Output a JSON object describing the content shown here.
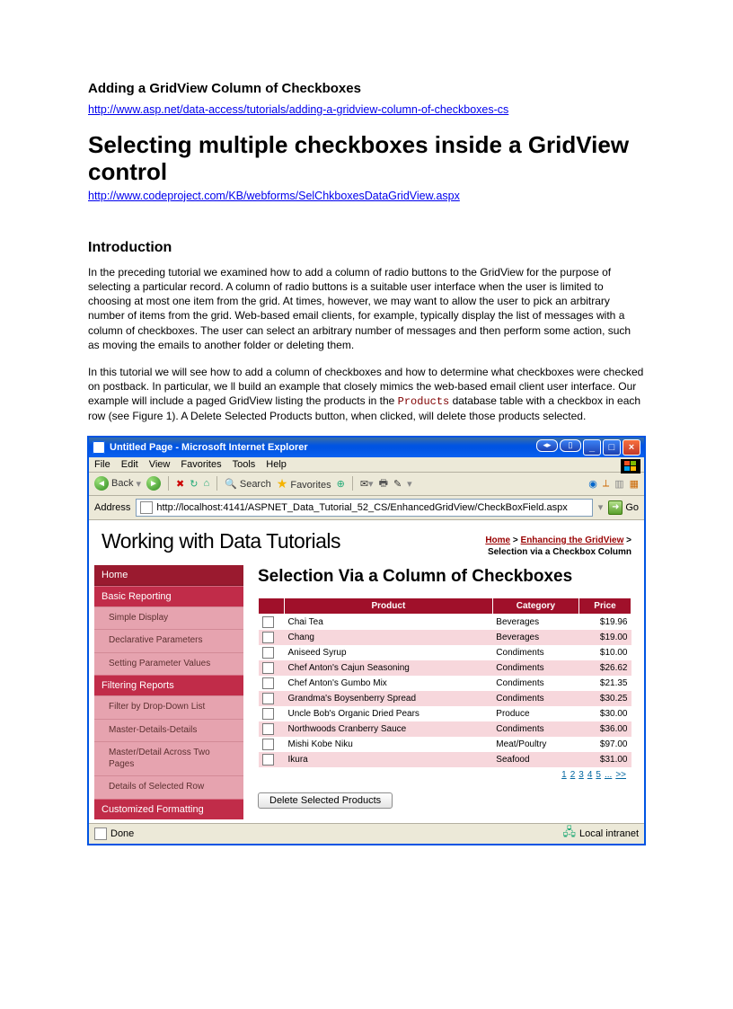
{
  "doc": {
    "title": "Adding  a GridView  Column  of Checkboxes",
    "link1": "http://www.asp.net/data-access/tutorials/adding-a-gridview-column-of-checkboxes-cs",
    "heading": "Selecting multiple checkboxes inside a GridView control",
    "link2": "http://www.codeproject.com/KB/webforms/SelChkboxesDataGridView.aspx",
    "intro_heading": "Introduction",
    "para1": "In the preceding tutorial we examined how to add a column of radio buttons to the GridView for the purpose of selecting a particular record. A column of radio buttons is a suitable user interface when the user is limited to choosing at most one item from the grid. At times, however, we may want to allow the user to pick an arbitrary number of items from the grid. Web-based email clients, for example, typically display the list of messages with a column of checkboxes. The user can select an arbitrary number of messages and then perform some action, such as moving the emails to another folder or deleting them.",
    "para2_a": "In this tutorial we will see how to add a column of checkboxes and how to determine what checkboxes were checked on postback. In particular, we ll build an example that closely mimics the web-based email client user interface. Our example will include a paged GridView listing the products in the ",
    "para2_code": "Products",
    "para2_b": " database table with a checkbox in each row (see Figure 1). A Delete Selected Products button, when clicked, will delete those products selected."
  },
  "browser": {
    "window_title": "Untitled Page - Microsoft Internet Explorer",
    "menus": [
      "File",
      "Edit",
      "View",
      "Favorites",
      "Tools",
      "Help"
    ],
    "toolbar": {
      "back": "Back",
      "search": "Search",
      "favorites": "Favorites"
    },
    "address_label": "Address",
    "url": "http://localhost:4141/ASPNET_Data_Tutorial_52_CS/EnhancedGridView/CheckBoxField.aspx",
    "go": "Go",
    "status_left": "Done",
    "status_right": "Local intranet"
  },
  "site": {
    "title": "Working with Data Tutorials",
    "breadcrumb": {
      "home": "Home",
      "section": "Enhancing the GridView",
      "current": "Selection via a Checkbox Column"
    },
    "sidebar": {
      "home": "Home",
      "basic_reporting": "Basic Reporting",
      "basic_items": [
        "Simple Display",
        "Declarative Parameters",
        "Setting Parameter Values"
      ],
      "filtering": "Filtering Reports",
      "filtering_items": [
        "Filter by Drop-Down List",
        "Master-Details-Details",
        "Master/Detail Across Two Pages",
        "Details of Selected Row"
      ],
      "customized": "Customized Formatting"
    },
    "page_heading": "Selection Via a Column of Checkboxes",
    "grid": {
      "headers": [
        "Product",
        "Category",
        "Price"
      ],
      "rows": [
        {
          "product": "Chai Tea",
          "category": "Beverages",
          "price": "$19.96"
        },
        {
          "product": "Chang",
          "category": "Beverages",
          "price": "$19.00"
        },
        {
          "product": "Aniseed Syrup",
          "category": "Condiments",
          "price": "$10.00"
        },
        {
          "product": "Chef Anton's Cajun Seasoning",
          "category": "Condiments",
          "price": "$26.62"
        },
        {
          "product": "Chef Anton's Gumbo Mix",
          "category": "Condiments",
          "price": "$21.35"
        },
        {
          "product": "Grandma's Boysenberry Spread",
          "category": "Condiments",
          "price": "$30.25"
        },
        {
          "product": "Uncle Bob's Organic Dried Pears",
          "category": "Produce",
          "price": "$30.00"
        },
        {
          "product": "Northwoods Cranberry Sauce",
          "category": "Condiments",
          "price": "$36.00"
        },
        {
          "product": "Mishi Kobe Niku",
          "category": "Meat/Poultry",
          "price": "$97.00"
        },
        {
          "product": "Ikura",
          "category": "Seafood",
          "price": "$31.00"
        }
      ],
      "pager": [
        "1",
        "2",
        "3",
        "4",
        "5",
        "...",
        ">>"
      ]
    },
    "delete_button": "Delete Selected Products"
  }
}
